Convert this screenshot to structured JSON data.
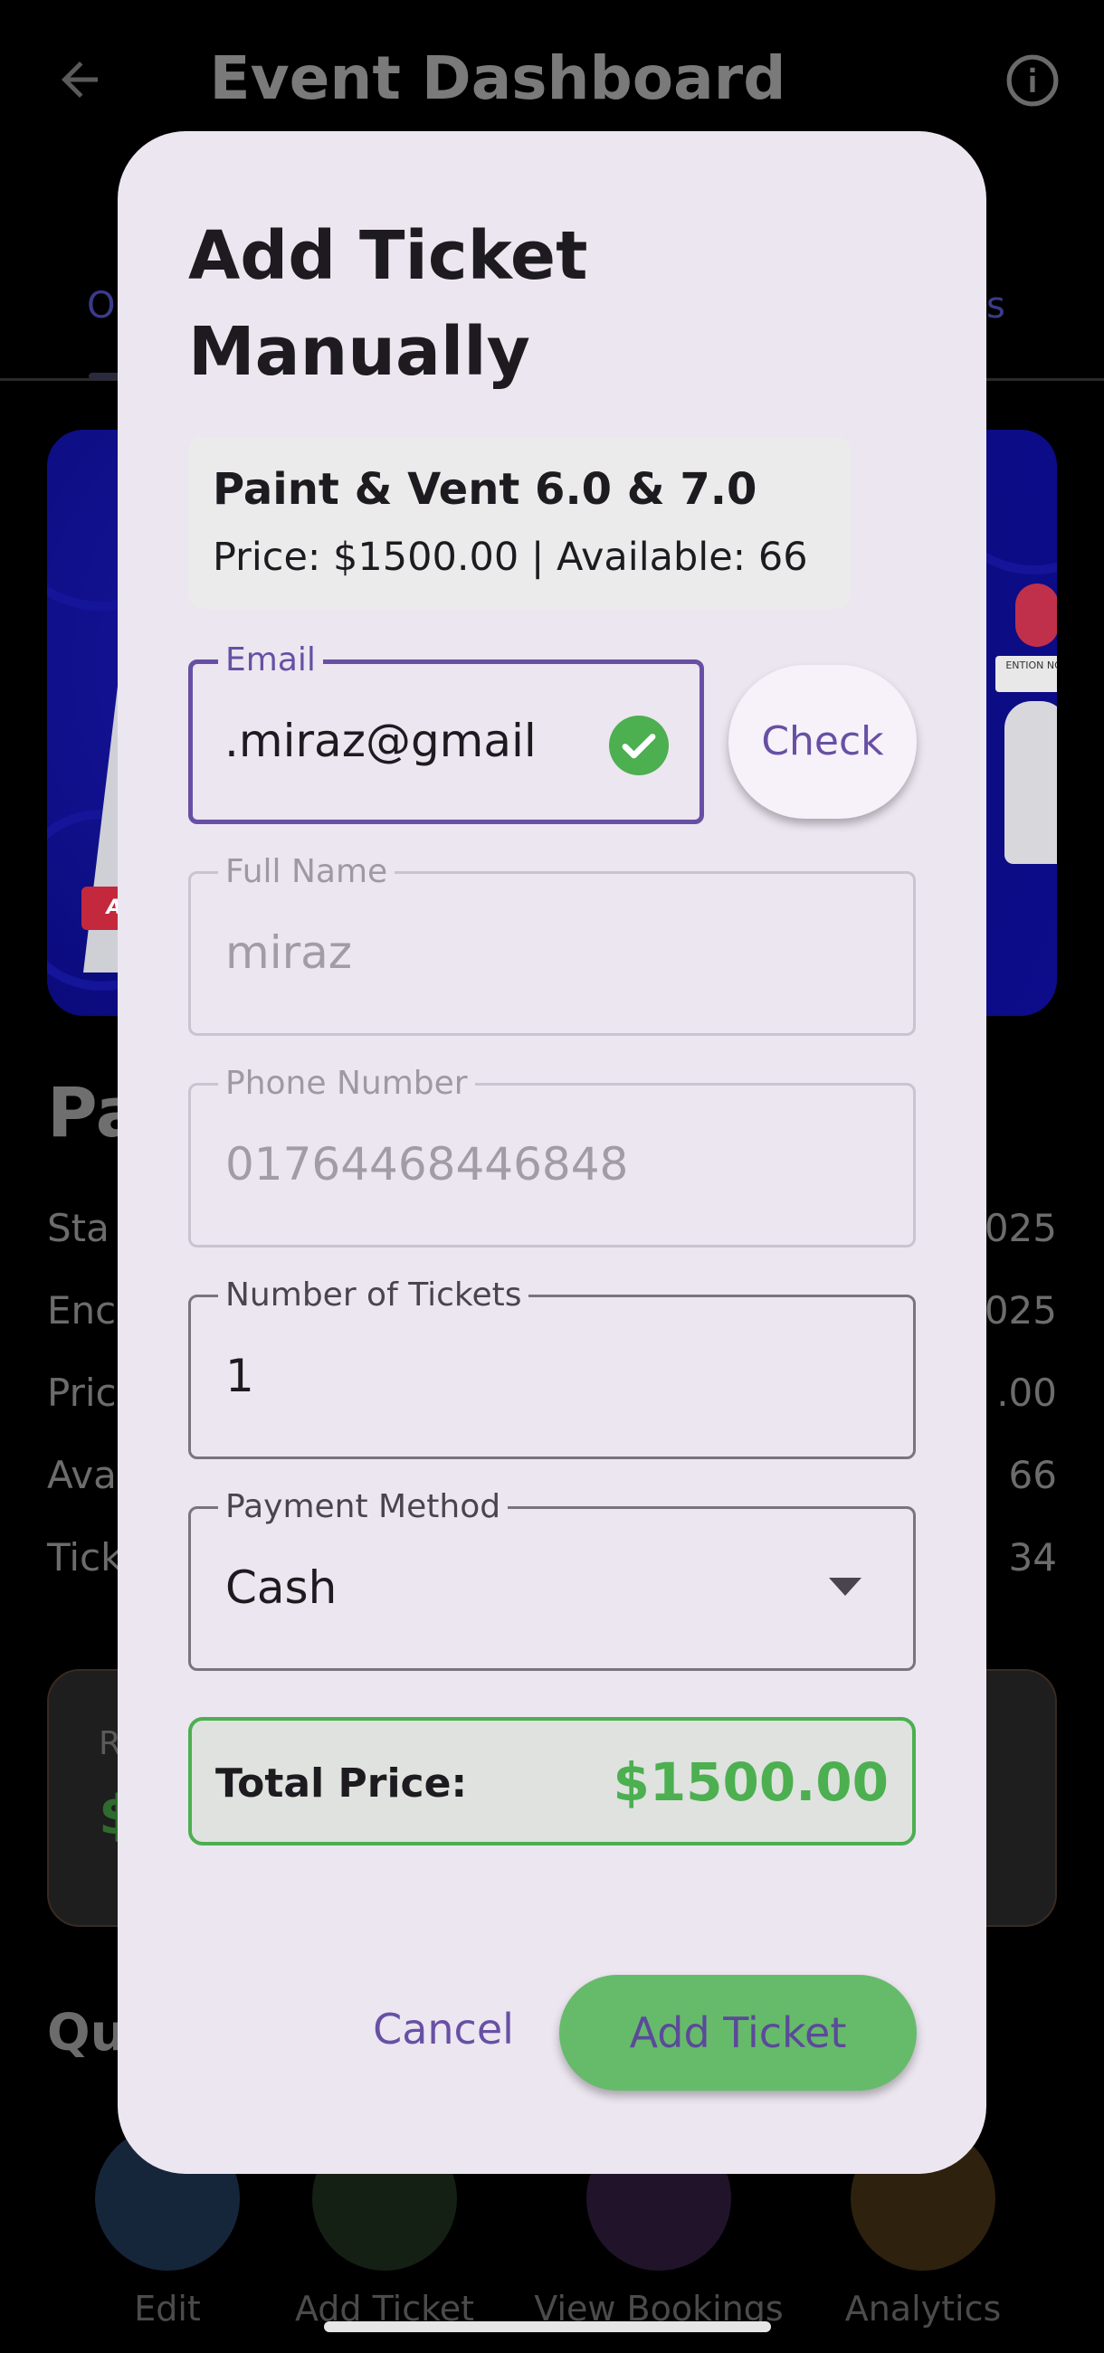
{
  "app_bar": {
    "title": "Event Dashboard"
  },
  "background": {
    "tab_left": "O",
    "tab_right": "s",
    "event_image": {
      "badge_text": "ENTION\nNORK",
      "tag_text": "AO"
    },
    "heading": "Pa",
    "rows": [
      {
        "label": "Sta",
        "value": "025"
      },
      {
        "label": "Enc",
        "value": "025"
      },
      {
        "label": "Pric",
        "value": ".00"
      },
      {
        "label": "Ava",
        "value": "66"
      },
      {
        "label": "Tick",
        "value": "34"
      }
    ],
    "revenue_card": {
      "label": "R",
      "value": "$"
    },
    "quick_heading": "Qu",
    "quick_actions": [
      {
        "label": "Edit",
        "color": "#1a2e48"
      },
      {
        "label": "Add Ticket",
        "color": "#1a2a1a"
      },
      {
        "label": "View Bookings",
        "color": "#2a1a34"
      },
      {
        "label": "Analytics",
        "color": "#3a2a12"
      }
    ]
  },
  "dialog": {
    "title": "Add Ticket Manually",
    "event": {
      "name": "Paint & Vent 6.0 & 7.0",
      "meta": "Price: $1500.00 | Available: 66"
    },
    "email": {
      "label": "Email",
      "value": "miraz@gmail."
    },
    "check_button": "Check",
    "full_name": {
      "label": "Full Name",
      "value": "miraz"
    },
    "phone": {
      "label": "Phone Number",
      "value": "01764468446848"
    },
    "tickets": {
      "label": "Number of Tickets",
      "value": "1"
    },
    "payment": {
      "label": "Payment Method",
      "value": "Cash"
    },
    "total": {
      "label": "Total Price:",
      "value": "$1500.00"
    },
    "cancel_button": "Cancel",
    "add_button": "Add Ticket"
  },
  "colors": {
    "primary": "#6750a4",
    "success": "#4caf50",
    "dialog_bg": "#ece6f0"
  }
}
